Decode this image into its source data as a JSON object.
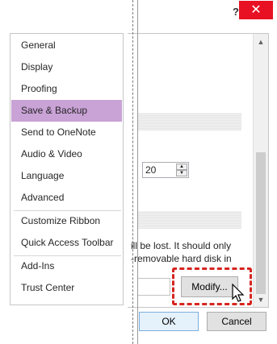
{
  "titlebar": {
    "help_label": "?",
    "close_label": "✕"
  },
  "nav": {
    "items": [
      {
        "label": "General",
        "selected": false
      },
      {
        "label": "Display",
        "selected": false
      },
      {
        "label": "Proofing",
        "selected": false
      },
      {
        "label": "Save & Backup",
        "selected": true
      },
      {
        "label": "Send to OneNote",
        "selected": false
      },
      {
        "label": "Audio & Video",
        "selected": false
      },
      {
        "label": "Language",
        "selected": false
      },
      {
        "label": "Advanced",
        "selected": false
      },
      {
        "label": "Customize Ribbon",
        "selected": false
      },
      {
        "label": "Quick Access Toolbar",
        "selected": false
      },
      {
        "label": "Add-Ins",
        "selected": false
      },
      {
        "label": "Trust Center",
        "selected": false
      }
    ]
  },
  "content": {
    "spinner_value": "20",
    "text_line_1": "ill be lost. It should only",
    "text_line_2": "-removable hard disk in",
    "modify_label": "Modify..."
  },
  "footer": {
    "ok_label": "OK",
    "cancel_label": "Cancel"
  },
  "colors": {
    "selected_nav": "#c9a2d6",
    "highlight": "#d6251f",
    "close": "#e81123"
  }
}
